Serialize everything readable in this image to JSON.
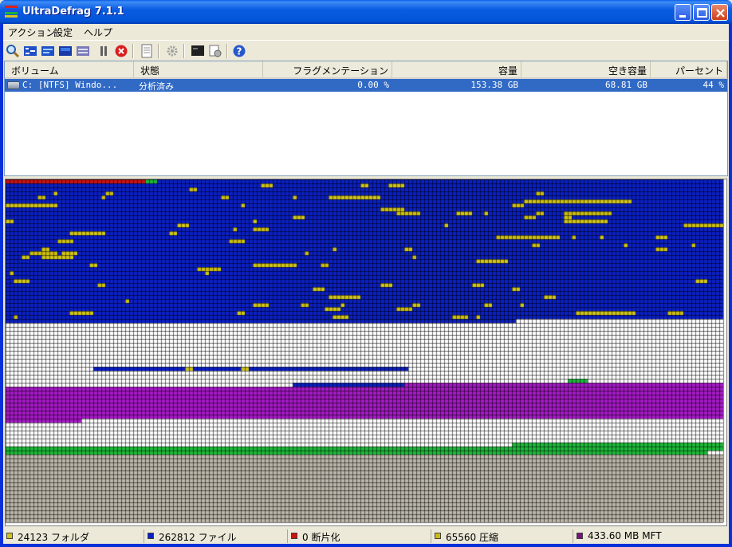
{
  "window": {
    "title": "UltraDefrag 7.1.1"
  },
  "menu": [
    "アクション",
    "設定",
    "ヘルプ"
  ],
  "toolbar": {
    "tools": [
      "analyze-icon",
      "defragment-icon",
      "quick-optimize-icon",
      "full-optimize-icon",
      "mft-optimize-icon",
      "pause-icon",
      "stop-icon",
      "report-icon",
      "settings-icon",
      "boot-time-script-icon",
      "boot-time-settings-icon",
      "help-icon"
    ]
  },
  "volumes": {
    "columns": [
      "ボリューム",
      "状態",
      "フラグメンテーション",
      "容量",
      "空き容量",
      "パーセント"
    ],
    "rows": [
      {
        "volume": "C: [NTFS]  Windo...",
        "status": "分析済み",
        "fragmentation": "0.00 %",
        "capacity": "153.38 GB",
        "free": "68.81 GB",
        "percent": "44 %"
      }
    ]
  },
  "cluster_map": {
    "colors": {
      "free": "#ffffff",
      "grid": "#000000",
      "files": "#0b20c4",
      "folders": "#d0c419",
      "fragmented": "#ca1313",
      "compressed": "#cbbd10",
      "mft": "#a61ac6",
      "system": "#1dba3a",
      "unused_tail": "#bcb6aa"
    }
  },
  "status": {
    "folders": "24123 フォルダ",
    "files": "262812 ファイル",
    "fragmented": "0 断片化",
    "compressed": "65560 圧縮",
    "mft": "433.60 MB MFT",
    "colors": {
      "folders": "#d0c419",
      "files": "#0b20c4",
      "fragmented": "#ca1313",
      "compressed": "#cbbd10",
      "mft": "#7a1280"
    }
  }
}
